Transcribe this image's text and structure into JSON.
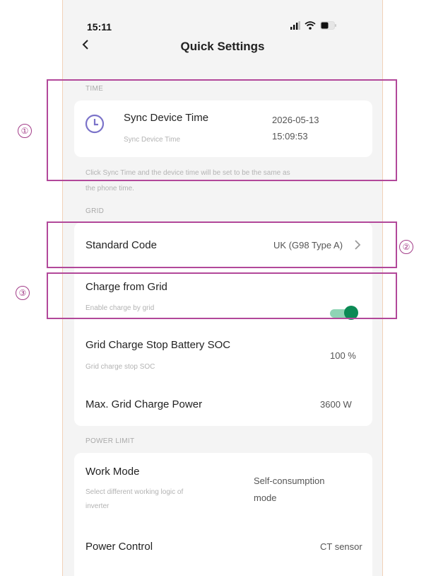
{
  "status_bar": {
    "time": "15:11",
    "icons": [
      "signal-icon",
      "wifi-icon",
      "battery-icon"
    ]
  },
  "header": {
    "back_icon": "chevron-left-icon",
    "title": "Quick Settings"
  },
  "sections": {
    "time": {
      "label": "TIME",
      "sync_title": "Sync Device Time",
      "sync_subtitle": "Sync Device Time",
      "date": "2026-05-13",
      "clock": "15:09:53",
      "note_line1": "Click Sync Time and the device time will be set to be the same as",
      "note_line2": "the phone time."
    },
    "grid": {
      "label": "GRID",
      "standard_code_label": "Standard Code",
      "standard_code_value": "UK (G98 Type A)",
      "charge_from_grid_label": "Charge from Grid",
      "charge_from_grid_sub": "Enable charge by grid",
      "charge_from_grid_on": true,
      "stop_soc_label": "Grid Charge Stop Battery SOC",
      "stop_soc_sub": "Grid charge stop SOC",
      "stop_soc_value": "100 %",
      "max_power_label": "Max. Grid Charge Power",
      "max_power_value": "3600 W"
    },
    "power_limit": {
      "label": "POWER LIMIT",
      "work_mode_label": "Work Mode",
      "work_mode_sub_line1": "Select different working logic of",
      "work_mode_sub_line2": "inverter",
      "work_mode_value_line1": "Self-consumption",
      "work_mode_value_line2": "mode",
      "power_control_label": "Power Control",
      "power_control_value": "CT sensor"
    }
  },
  "annotations": {
    "one": "①",
    "two": "②",
    "three": "③"
  },
  "colors": {
    "accent_green": "#0b8a55",
    "annotation_magenta": "#b2489a",
    "clock_purple": "#7b73c9"
  }
}
